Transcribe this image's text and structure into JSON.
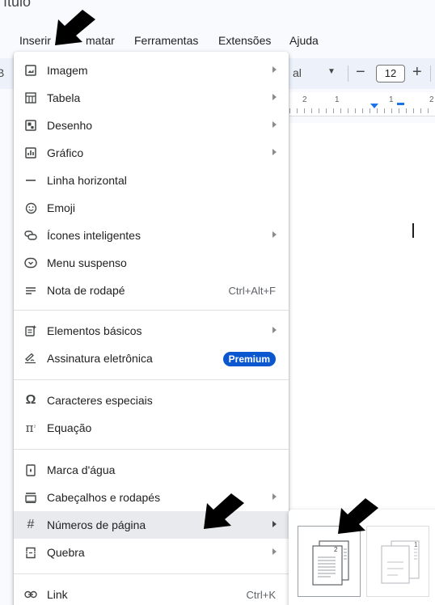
{
  "title_partial": "ítulo",
  "menubar": {
    "inserir": "Inserir",
    "formatar": "matar",
    "ferramentas": "Ferramentas",
    "extensoes": "Extensões",
    "ajuda": "Ajuda"
  },
  "toolbar": {
    "font_partial": "al",
    "font_size": "12",
    "minus": "−",
    "plus": "+"
  },
  "ruler": {
    "labels": [
      "2",
      "1",
      "1",
      "2"
    ]
  },
  "menu": {
    "items": [
      {
        "label": "Imagem",
        "icon": "image-icon",
        "submenu": true
      },
      {
        "label": "Tabela",
        "icon": "table-icon",
        "submenu": true
      },
      {
        "label": "Desenho",
        "icon": "drawing-icon",
        "submenu": true
      },
      {
        "label": "Gráfico",
        "icon": "chart-icon",
        "submenu": true
      },
      {
        "label": "Linha horizontal",
        "icon": "horizontal-line-icon"
      },
      {
        "label": "Emoji",
        "icon": "emoji-icon"
      },
      {
        "label": "Ícones inteligentes",
        "icon": "smart-chips-icon",
        "submenu": true
      },
      {
        "label": "Menu suspenso",
        "icon": "dropdown-icon"
      },
      {
        "label": "Nota de rodapé",
        "icon": "footnote-icon",
        "shortcut": "Ctrl+Alt+F"
      },
      {
        "label": "Elementos básicos",
        "icon": "building-blocks-icon",
        "submenu": true
      },
      {
        "label": "Assinatura eletrônica",
        "icon": "esignature-icon",
        "badge": "Premium"
      },
      {
        "label": "Caracteres especiais",
        "icon": "omega-icon"
      },
      {
        "label": "Equação",
        "icon": "pi-icon"
      },
      {
        "label": "Marca d'água",
        "icon": "watermark-icon"
      },
      {
        "label": "Cabeçalhos e rodapés",
        "icon": "header-footer-icon",
        "submenu": true
      },
      {
        "label": "Números de página",
        "icon": "hash-icon",
        "submenu": true
      },
      {
        "label": "Quebra",
        "icon": "break-icon",
        "submenu": true
      },
      {
        "label": "Link",
        "icon": "link-icon",
        "shortcut": "Ctrl+K"
      }
    ]
  },
  "submenu": {
    "option1_number": "2",
    "option2_number": "1"
  },
  "colors": {
    "accent": "#0b57d0",
    "hover": "#e8eaed",
    "ruler_marker": "#1a73e8"
  }
}
